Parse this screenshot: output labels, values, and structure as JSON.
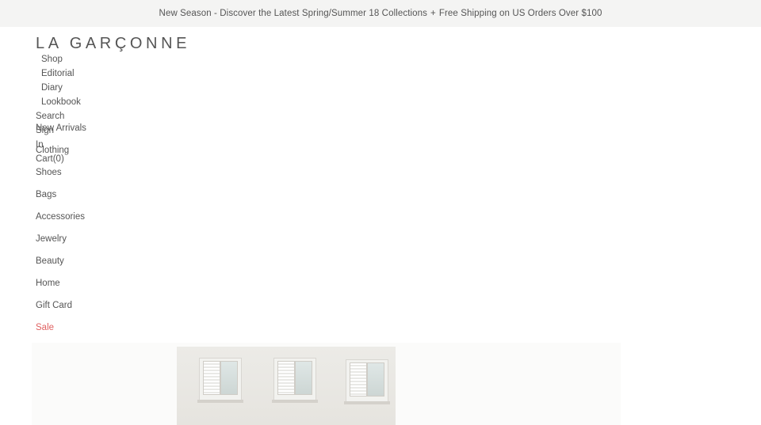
{
  "announcement": {
    "season_text": "New Season - Discover the Latest Spring/Summer 18 Collections",
    "separator": "+",
    "shipping_text": "Free Shipping on US Orders Over $100"
  },
  "brand": {
    "logo_text": "LA GARÇONNE"
  },
  "main_nav": {
    "items": [
      {
        "label": "Shop"
      },
      {
        "label": "Editorial"
      },
      {
        "label": "Diary"
      },
      {
        "label": "Lookbook"
      }
    ]
  },
  "utility_nav": {
    "search": "Search",
    "sign": "Sign",
    "in": "In",
    "cart": "Cart(0)"
  },
  "shop_menu": {
    "items": [
      {
        "label": "New Arrivals"
      },
      {
        "label": "Clothing"
      },
      {
        "label": "Shoes"
      },
      {
        "label": "Bags"
      },
      {
        "label": "Accessories"
      },
      {
        "label": "Jewelry"
      },
      {
        "label": "Beauty"
      },
      {
        "label": "Home"
      },
      {
        "label": "Gift Card"
      },
      {
        "label": "Sale"
      }
    ]
  },
  "colors": {
    "announcement_bg": "#f4f4f3",
    "text": "#555555",
    "sale": "#e06161"
  },
  "hero": {
    "image_description_icon": "building-windows-image"
  }
}
